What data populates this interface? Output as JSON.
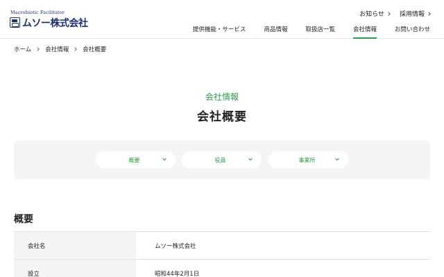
{
  "header": {
    "logo": {
      "tagline": "Macrobiotic Facilitator",
      "name": "ムソー株式会社"
    },
    "util_nav": [
      {
        "label": "お知らせ"
      },
      {
        "label": "採用情報"
      }
    ],
    "main_nav": [
      {
        "label": "提供機能・サービス"
      },
      {
        "label": "商品情報"
      },
      {
        "label": "取扱店一覧"
      },
      {
        "label": "会社情報",
        "active": true
      },
      {
        "label": "お問い合わせ"
      }
    ]
  },
  "breadcrumb": [
    "ホーム",
    "会社情報",
    "会社概要"
  ],
  "title": {
    "category": "会社情報",
    "main": "会社概要"
  },
  "anchors": [
    {
      "label": "概要"
    },
    {
      "label": "役員"
    },
    {
      "label": "事業所"
    }
  ],
  "section": {
    "title": "概要",
    "rows": [
      {
        "label": "会社名",
        "value": "ムソー株式会社"
      },
      {
        "label": "設立",
        "value": "昭和44年2月1日"
      }
    ]
  },
  "colors": {
    "accent": "#2f9a48",
    "brand": "#1b2f6e",
    "panel": "#f5f5f5"
  }
}
